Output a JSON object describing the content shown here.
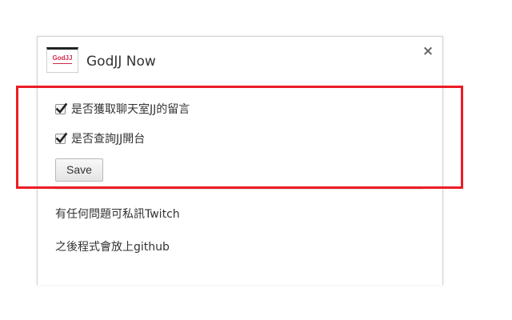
{
  "dialog": {
    "app_icon_text": "GodJJ",
    "title": "GodJJ Now",
    "close_glyph": "×"
  },
  "options": [
    {
      "label": "是否獲取聊天室JJ的留言",
      "checked": true
    },
    {
      "label": "是否查詢JJ開台",
      "checked": true
    }
  ],
  "save_label": "Save",
  "info": {
    "line1": "有任何問題可私訊Twitch",
    "line2": "之後程式會放上github"
  },
  "colors": {
    "highlight_border": "#ec1c24",
    "icon_accent": "#d1274b"
  },
  "icons": {
    "app_icon": "godjj-logo-icon",
    "close": "close-icon",
    "check": "checkmark-icon"
  }
}
